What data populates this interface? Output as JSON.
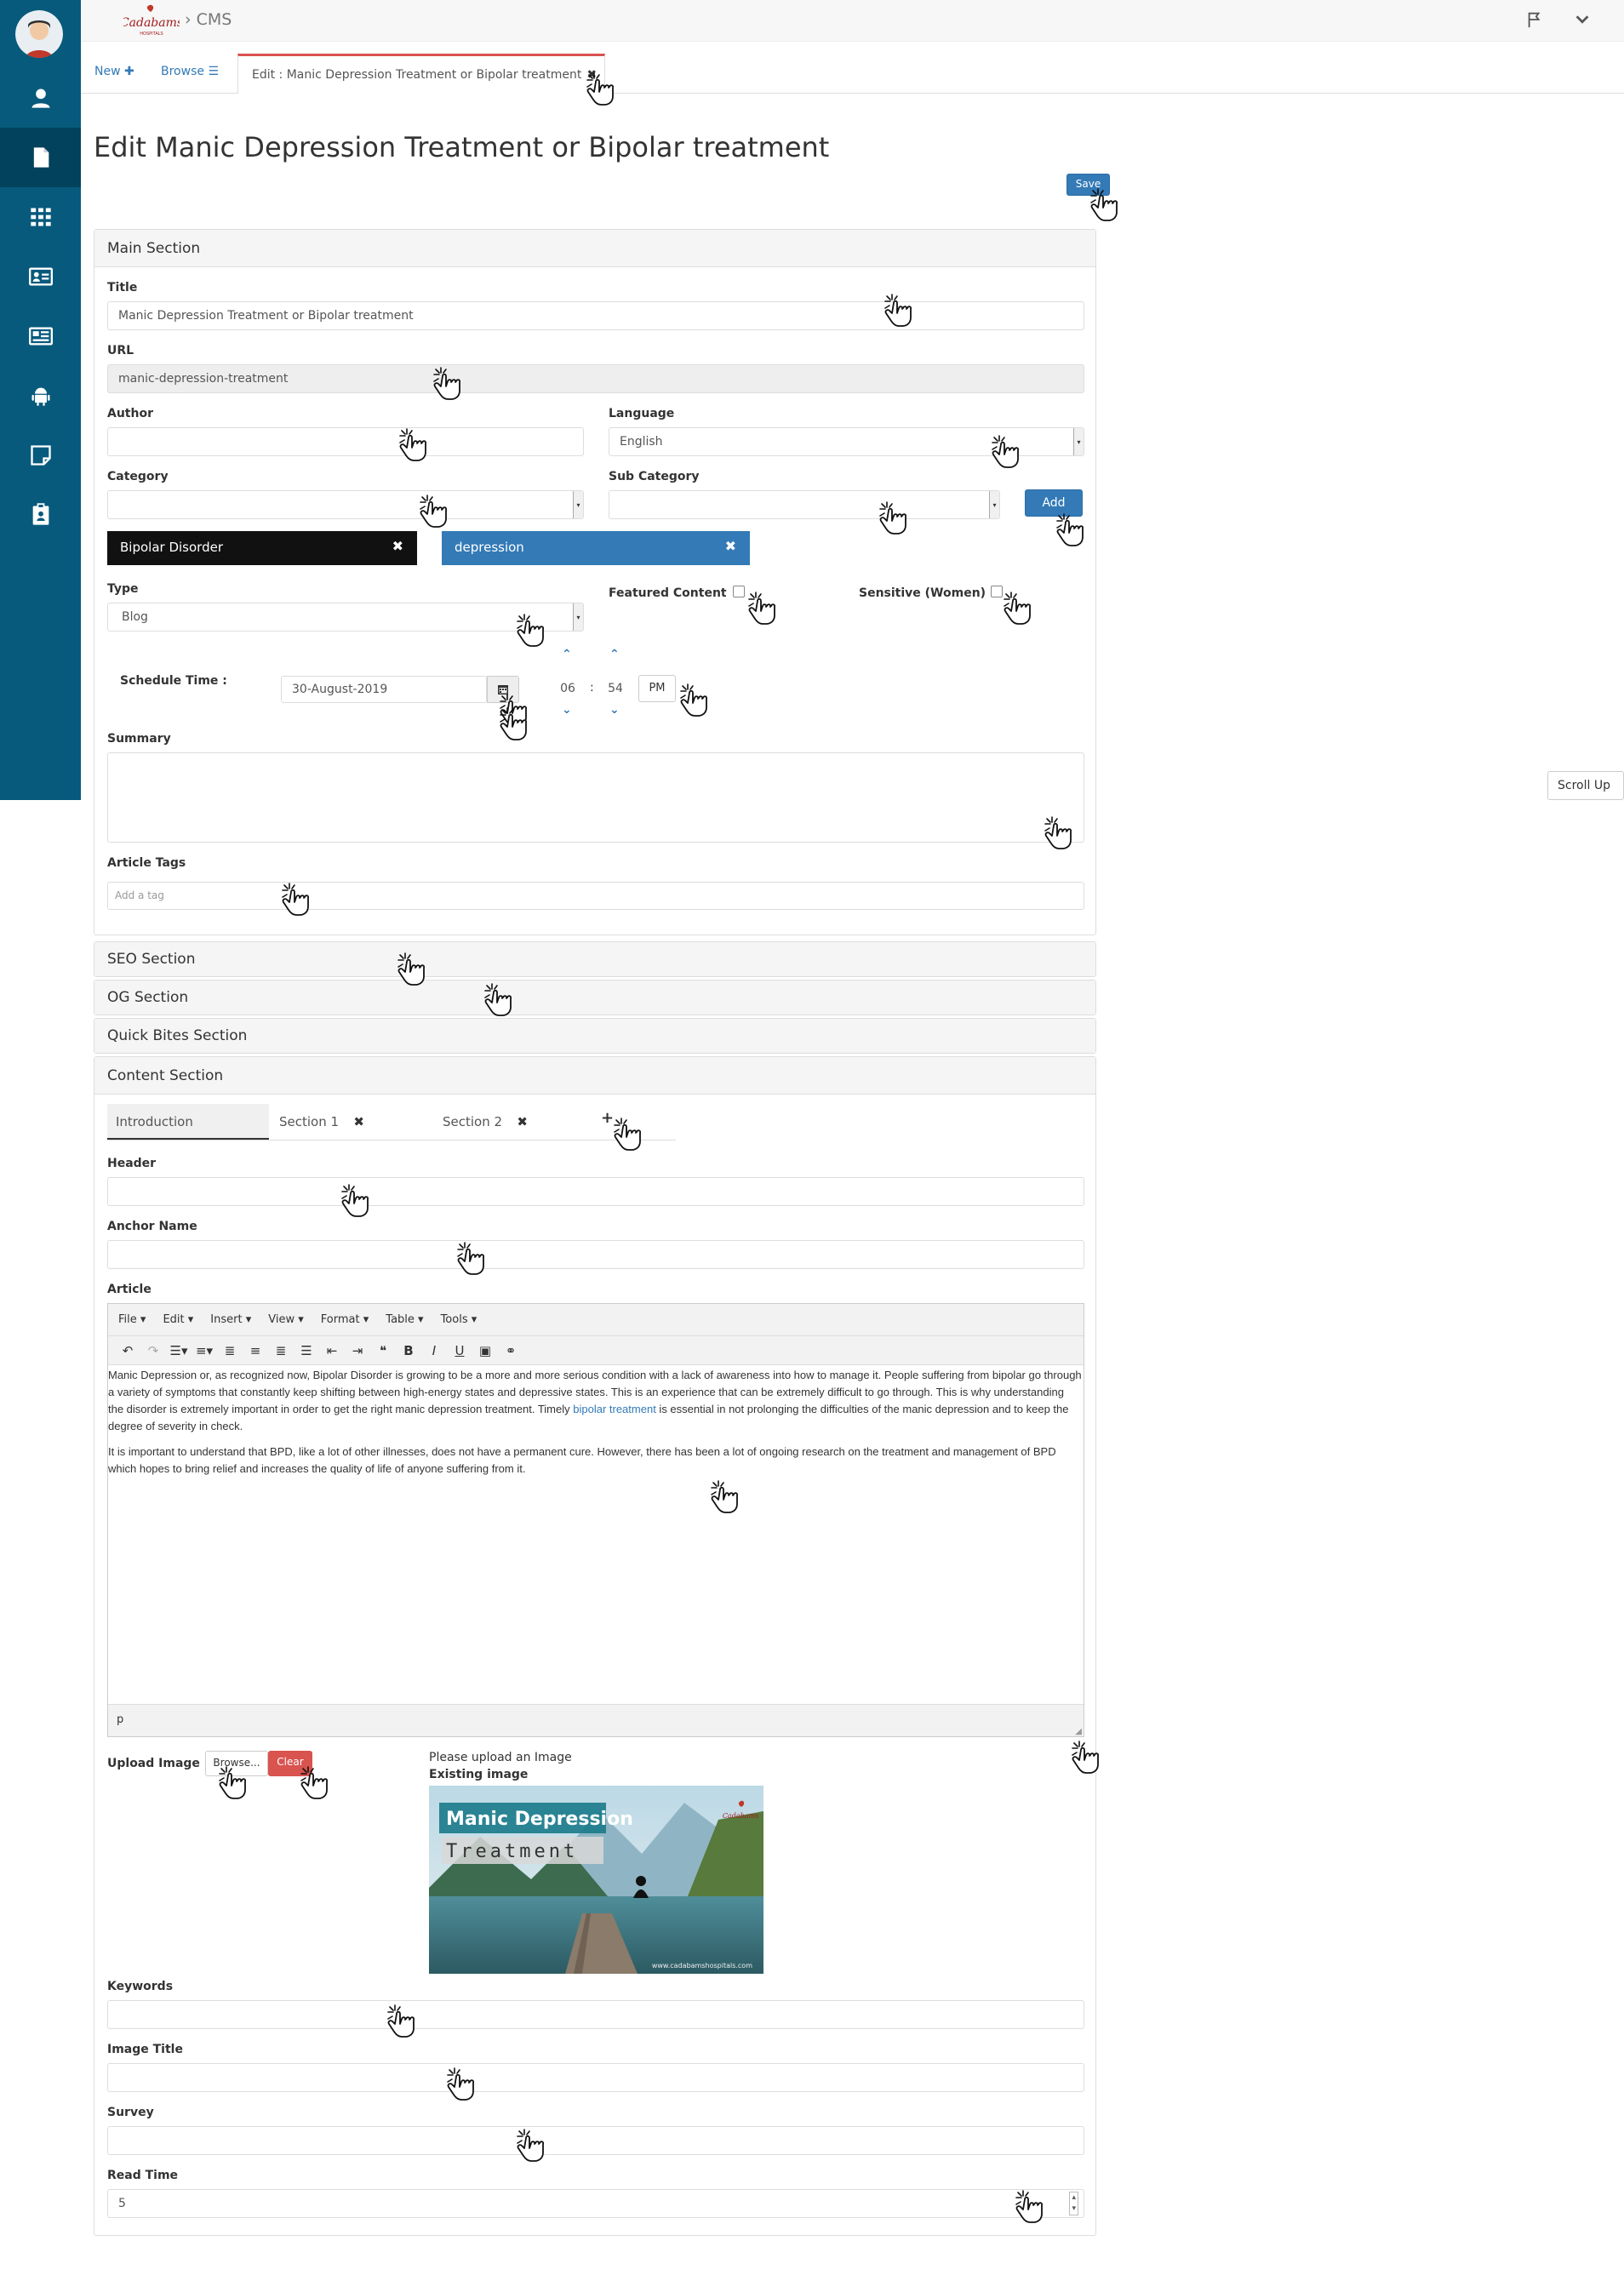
{
  "app": {
    "breadcrumb": "CMS",
    "logo_text": "Cadabams",
    "logo_sub": "HOSPITALS"
  },
  "tabs": {
    "new_label": "New",
    "browse_label": "Browse",
    "active_label": "Edit : Manic Depression Treatment or Bipolar treatment"
  },
  "page": {
    "title": "Edit Manic Depression Treatment or Bipolar treatment",
    "save_label": "Save",
    "scroll_up_label": "Scroll Up"
  },
  "main_section": {
    "heading": "Main Section",
    "title_label": "Title",
    "title_value": "Manic Depression Treatment or Bipolar treatment",
    "url_label": "URL",
    "url_value": "manic-depression-treatment",
    "author_label": "Author",
    "author_value": "",
    "language_label": "Language",
    "language_value": "English",
    "category_label": "Category",
    "category_value": "",
    "subcategory_label": "Sub Category",
    "subcategory_value": "",
    "add_label": "Add",
    "chips": [
      {
        "label": "Bipolar Disorder",
        "color": "#111111"
      },
      {
        "label": "depression",
        "color": "#337ab7"
      }
    ],
    "type_label": "Type",
    "type_value": "Blog",
    "featured_label": "Featured Content",
    "sensitive_label": "Sensitive (Women)",
    "schedule_label": "Schedule Time :",
    "schedule_date": "30-August-2019",
    "schedule_hour": "06",
    "schedule_minute": "54",
    "schedule_ampm": "PM",
    "time_sep": ":",
    "summary_label": "Summary",
    "summary_value": "",
    "tags_label": "Article Tags",
    "tags_placeholder": "Add a tag"
  },
  "collapsed_sections": {
    "seo": "SEO Section",
    "og": "OG Section",
    "quick_bites": "Quick Bites Section"
  },
  "content_section": {
    "heading": "Content Section",
    "tabs": [
      "Introduction",
      "Section 1",
      "Section 2"
    ],
    "add_tab": "+",
    "header_label": "Header",
    "anchor_label": "Anchor Name",
    "article_label": "Article",
    "menus": [
      "File",
      "Edit",
      "Insert",
      "View",
      "Format",
      "Table",
      "Tools"
    ],
    "article_p1_a": "Manic Depression or, as recognized now, Bipolar Disorder is growing to be a more and more serious condition with a lack of awareness into how to manage it. People suffering from bipolar go through a variety of symptoms that constantly keep shifting between high-energy states and depressive states. This is an experience that can be extremely difficult to go through. This is why understanding the disorder is extremely important in order to get the right manic depression treatment. Timely ",
    "article_link": "bipolar treatment",
    "article_p1_b": " is essential in not prolonging the difficulties of the manic depression and to keep the degree of severity in check.",
    "article_p2": "It is important to understand that BPD, like a lot of other illnesses, does not have a permanent cure. However, there has been a lot of ongoing research on the treatment and management of BPD which hopes to bring relief and increases the quality of life of anyone suffering from it.",
    "status_path": "p",
    "upload_label": "Upload Image",
    "browse_btn": "Browse...",
    "clear_btn": "Clear",
    "upload_hint": "Please upload an Image",
    "existing_label": "Existing image",
    "image_title_line1": "Manic Depression",
    "image_title_line2": "Treatment",
    "image_footer": "www.cadabamshospitals.com",
    "keywords_label": "Keywords",
    "image_title_label": "Image Title",
    "survey_label": "Survey",
    "read_time_label": "Read Time",
    "read_time_value": "5"
  }
}
